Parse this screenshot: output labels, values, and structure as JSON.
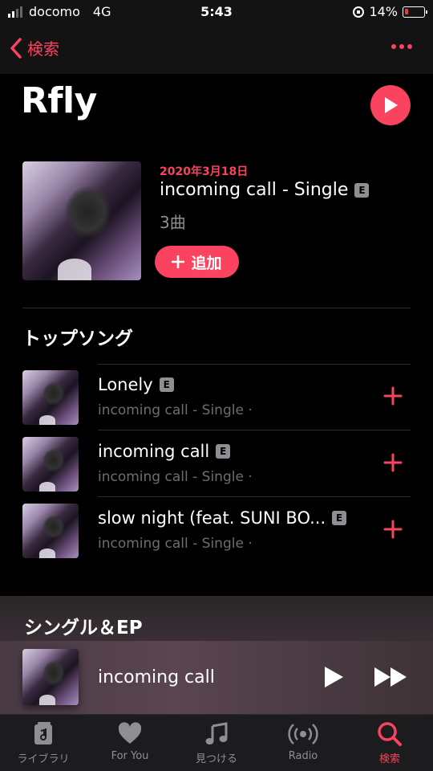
{
  "status_bar": {
    "carrier": "docomo",
    "network": "4G",
    "time": "5:43",
    "battery": "14%"
  },
  "nav": {
    "back_label": "検索"
  },
  "artist": {
    "name": "Rfly"
  },
  "latest_release": {
    "date": "2020年3月18日",
    "title": "incoming call - Single",
    "explicit_badge": "E",
    "track_count": "3曲",
    "add_label": "追加"
  },
  "top_songs": {
    "heading": "トップソング",
    "items": [
      {
        "title": "Lonely",
        "badge": "E",
        "subtitle": "incoming call - Single ·"
      },
      {
        "title": "incoming call",
        "badge": "E",
        "subtitle": "incoming call - Single ·"
      },
      {
        "title": "slow night (feat. SUNI BO...",
        "badge": "E",
        "subtitle": "incoming call - Single ·"
      }
    ]
  },
  "singles_heading": "シングル＆EP",
  "mini_player": {
    "title": "incoming call"
  },
  "tabs": [
    {
      "label": "ライブラリ",
      "icon": "library-icon"
    },
    {
      "label": "For You",
      "icon": "heart-icon"
    },
    {
      "label": "見つける",
      "icon": "music-note-icon"
    },
    {
      "label": "Radio",
      "icon": "radio-icon"
    },
    {
      "label": "検索",
      "icon": "search-icon",
      "active": true
    }
  ],
  "colors": {
    "accent": "#fa435e",
    "background": "#000000",
    "secondary_text": "#8e8e93"
  }
}
